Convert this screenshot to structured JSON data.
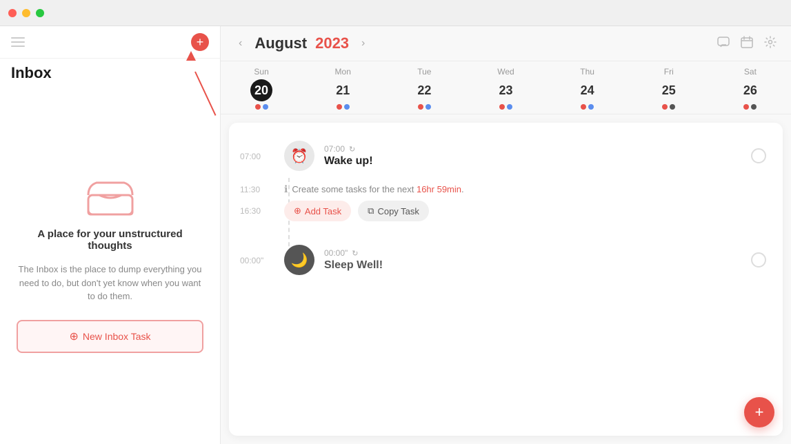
{
  "titlebar": {
    "buttons": [
      "close",
      "minimize",
      "maximize"
    ]
  },
  "sidebar": {
    "title": "Inbox",
    "add_btn_label": "+",
    "empty_title": "A place for your unstructured thoughts",
    "empty_desc": "The Inbox is the place to dump everything you need to do, but don't yet know when you want to do them.",
    "new_task_btn": "New Inbox Task"
  },
  "calendar": {
    "month": "August",
    "year": "2023",
    "nav_prev": "‹",
    "nav_next": "›",
    "days": [
      {
        "name": "Sun",
        "num": "20",
        "today": true,
        "dots": [
          "red",
          "blue-dark"
        ]
      },
      {
        "name": "Mon",
        "num": "21",
        "today": false,
        "dots": [
          "red",
          "blue"
        ]
      },
      {
        "name": "Tue",
        "num": "22",
        "today": false,
        "dots": [
          "red",
          "blue"
        ]
      },
      {
        "name": "Wed",
        "num": "23",
        "today": false,
        "dots": [
          "red",
          "blue"
        ]
      },
      {
        "name": "Thu",
        "num": "24",
        "today": false,
        "dots": [
          "red",
          "blue"
        ]
      },
      {
        "name": "Fri",
        "num": "25",
        "today": false,
        "dots": [
          "red",
          "blue-dark"
        ]
      },
      {
        "name": "Sat",
        "num": "26",
        "today": false,
        "dots": [
          "red",
          "dark"
        ]
      }
    ]
  },
  "timeline": {
    "times": {
      "t1": "07:00",
      "t2": "11:30",
      "t3": "16:30",
      "t4": "00:00\""
    },
    "events": [
      {
        "time": "07:00",
        "icon": "⏰",
        "icon_type": "alarm",
        "title": "Wake up!",
        "has_check": true
      },
      {
        "time": "00:00\"",
        "icon": "🌙",
        "icon_type": "moon",
        "title": "Sleep Well!",
        "has_check": true
      }
    ],
    "info": {
      "text_before": "Create some tasks for the next ",
      "highlight": "16hr 59min",
      "text_after": ".",
      "add_task": "Add Task",
      "copy_task": "Copy Task"
    }
  },
  "fab": {
    "label": "+"
  }
}
